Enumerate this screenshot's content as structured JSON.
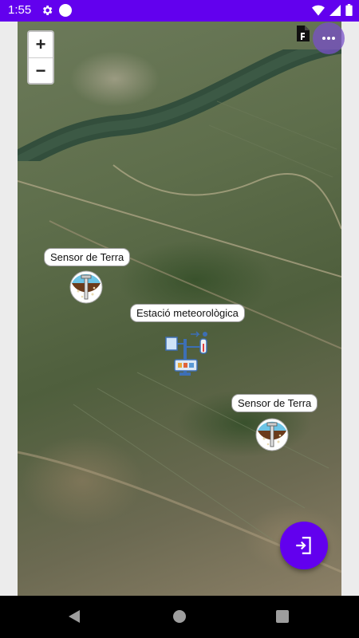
{
  "status_bar": {
    "time": "1:55",
    "icons": [
      "gear-icon",
      "circle-icon",
      "wifi-icon",
      "signal-icon",
      "battery-icon"
    ]
  },
  "map": {
    "zoom_in_label": "+",
    "zoom_out_label": "−",
    "markers": [
      {
        "label": "Sensor de Terra",
        "icon": "soil-sensor-icon"
      },
      {
        "label": "Estació meteorològica",
        "icon": "weather-station-icon"
      },
      {
        "label": "Sensor de Terra",
        "icon": "soil-sensor-icon"
      }
    ]
  },
  "fab": {
    "icon": "logout-icon"
  },
  "colors": {
    "primary": "#6200ee",
    "navbar": "#000000",
    "label_bg": "#ffffff"
  }
}
